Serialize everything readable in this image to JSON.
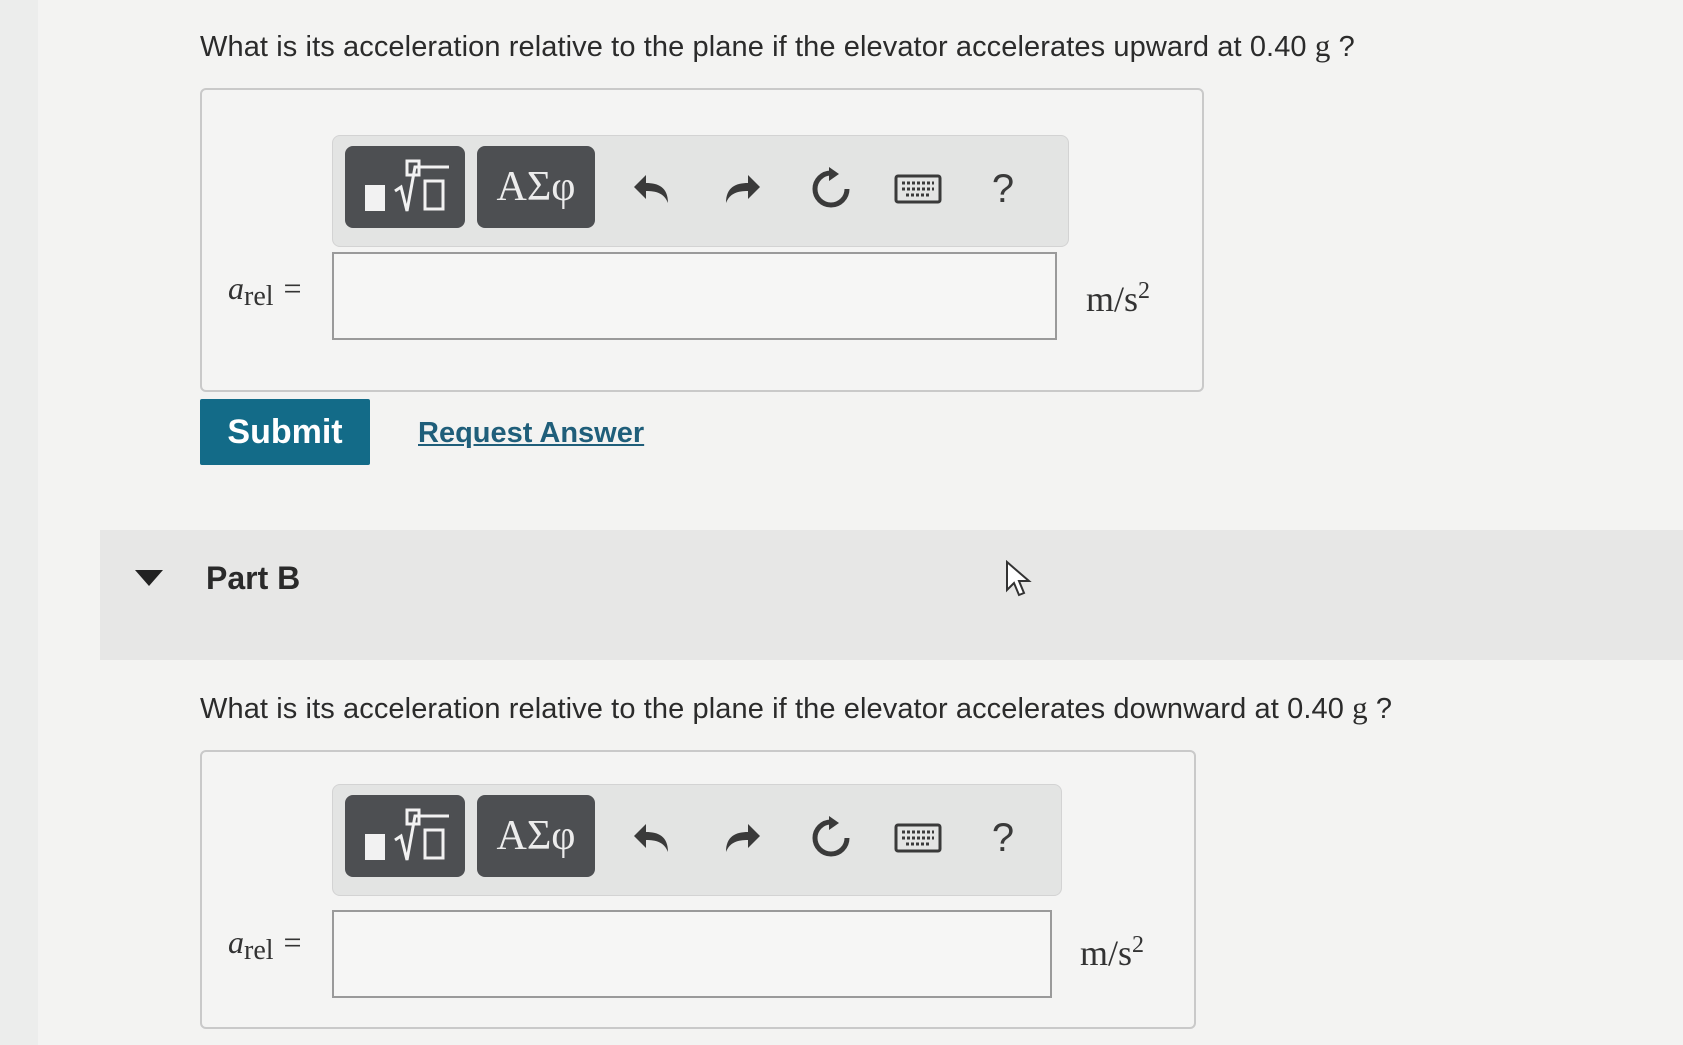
{
  "partA": {
    "question_prefix": "What is its acceleration relative to the plane if the elevator accelerates upward at 0.40",
    "question_unit": "g",
    "question_suffix": " ?",
    "toolbar": {
      "templates_icon": "fraction-radical-icon",
      "greek_label": "ΑΣφ",
      "help_label": "?"
    },
    "variable": "a",
    "subscript": "rel",
    "equals": "=",
    "input_value": "",
    "unit_base": "m/s",
    "unit_exp": "2",
    "submit_label": "Submit",
    "request_label": "Request Answer"
  },
  "partB": {
    "title": "Part B",
    "question_prefix": "What is its acceleration relative to the plane if the elevator accelerates downward at 0.40",
    "question_unit": "g",
    "question_suffix": " ?",
    "toolbar": {
      "templates_icon": "fraction-radical-icon",
      "greek_label": "ΑΣφ",
      "help_label": "?"
    },
    "variable": "a",
    "subscript": "rel",
    "equals": "=",
    "input_value": "",
    "unit_base": "m/s",
    "unit_exp": "2"
  }
}
